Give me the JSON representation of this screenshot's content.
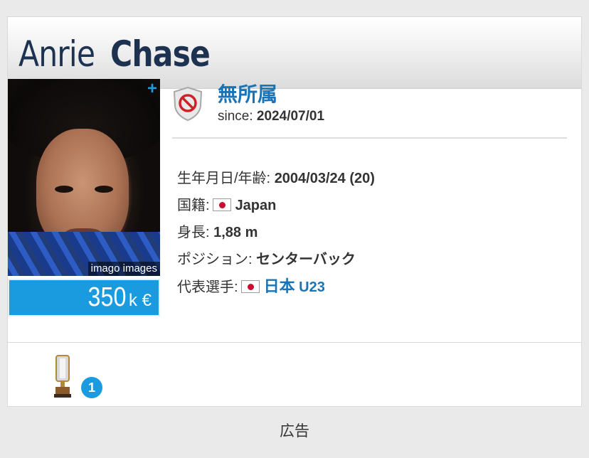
{
  "player": {
    "first_name": "Anrie",
    "last_name": "Chase",
    "photo_credit": "imago images",
    "add_icon": "+",
    "market_value": "350",
    "market_value_unit": "k €"
  },
  "club": {
    "name": "無所属",
    "since_label": "since:",
    "since_value": "2024/07/01",
    "icon": "no-club-shield-icon"
  },
  "details": {
    "birth_label": "生年月日/年齢:",
    "birth_value": "2004/03/24 (20)",
    "nationality_label": "国籍:",
    "nationality_value": "Japan",
    "height_label": "身長:",
    "height_value": "1,88 m",
    "position_label": "ポジション:",
    "position_value": "センターバック",
    "national_team_label": "代表選手:",
    "national_team_value": "日本",
    "national_team_suffix": "U23"
  },
  "trophies": {
    "count": "1",
    "icon": "trophy-icon"
  },
  "ad_label": "広告",
  "colors": {
    "accent": "#1a9be0",
    "link": "#1a73b5",
    "name": "#1d3150"
  }
}
